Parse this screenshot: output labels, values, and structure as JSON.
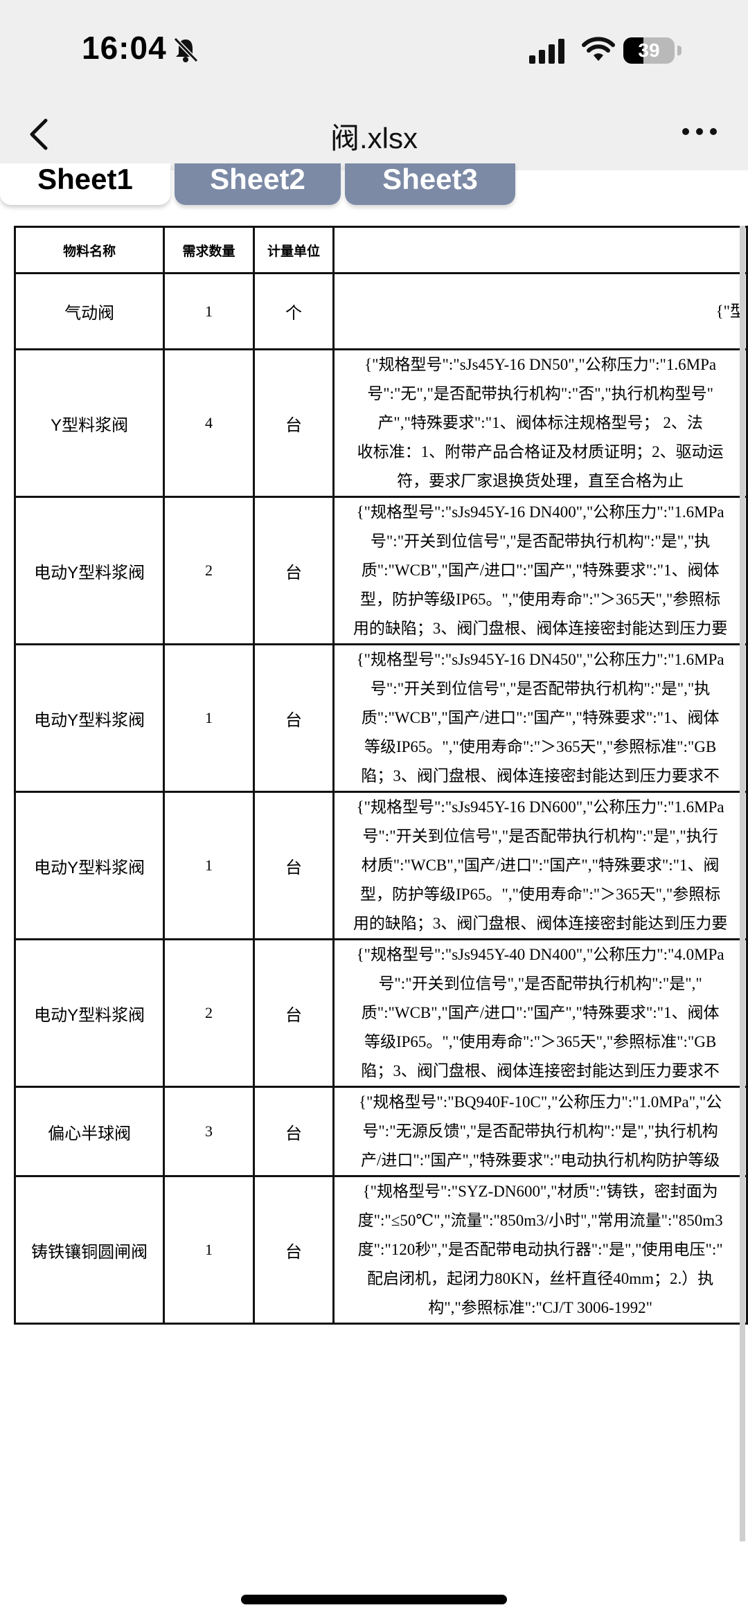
{
  "status_bar": {
    "time": "16:04",
    "battery_level": "39",
    "battery_fraction": 0.39
  },
  "nav": {
    "title": "阀.xlsx"
  },
  "sheets": [
    "Sheet1",
    "Sheet2",
    "Sheet3"
  ],
  "table": {
    "headers": [
      "物料名称",
      "需求数量",
      "计量单位"
    ],
    "rows": [
      {
        "name": "气动阀",
        "qty": "1",
        "unit": "个",
        "spec": [
          "{\"型"
        ]
      },
      {
        "name": "Y型料浆阀",
        "qty": "4",
        "unit": "台",
        "spec": [
          "{\"规格型号\":\"sJs45Y-16  DN50\",\"公称压力\":\"1.6MPa",
          "号\":\"无\",\"是否配带执行机构\":\"否\",\"执行机构型号\"",
          "产\",\"特殊要求\":\"1、阀体标注规格型号；          2、法",
          "收标准：1、附带产品合格证及材质证明；2、驱动运",
          "符，要求厂家退换货处理，直至合格为止"
        ]
      },
      {
        "name": "电动Y型料浆阀",
        "qty": "2",
        "unit": "台",
        "spec": [
          "{\"规格型号\":\"sJs945Y-16  DN400\",\"公称压力\":\"1.6MPa",
          "号\":\"开关到位信号\",\"是否配带执行机构\":\"是\",\"执",
          "质\":\"WCB\",\"国产/进口\":\"国产\",\"特殊要求\":\"1、阀体",
          "型，防护等级IP65。\",\"使用寿命\":\"＞365天\",\"参照标",
          "用的缺陷；3、阀门盘根、阀体连接密封能达到压力要"
        ]
      },
      {
        "name": "电动Y型料浆阀",
        "qty": "1",
        "unit": "台",
        "spec": [
          "{\"规格型号\":\"sJs945Y-16  DN450\",\"公称压力\":\"1.6MPa",
          "号\":\"开关到位信号\",\"是否配带执行机构\":\"是\",\"执",
          "质\":\"WCB\",\"国产/进口\":\"国产\",\"特殊要求\":\"1、阀体",
          "等级IP65。\",\"使用寿命\":\"＞365天\",\"参照标准\":\"GB",
          "陷；3、阀门盘根、阀体连接密封能达到压力要求不"
        ]
      },
      {
        "name": "电动Y型料浆阀",
        "qty": "1",
        "unit": "台",
        "spec": [
          "{\"规格型号\":\"sJs945Y-16  DN600\",\"公称压力\":\"1.6MPa",
          "号\":\"开关到位信号\",\"是否配带执行机构\":\"是\",\"执行",
          "材质\":\"WCB\",\"国产/进口\":\"国产\",\"特殊要求\":\"1、阀",
          "型，防护等级IP65。\",\"使用寿命\":\"＞365天\",\"参照标",
          "用的缺陷；3、阀门盘根、阀体连接密封能达到压力要"
        ]
      },
      {
        "name": "电动Y型料浆阀",
        "qty": "2",
        "unit": "台",
        "spec": [
          "{\"规格型号\":\"sJs945Y-40  DN400\",\"公称压力\":\"4.0MPa",
          "号\":\"开关到位信号\",\"是否配带执行机构\":\"是\",\"",
          "质\":\"WCB\",\"国产/进口\":\"国产\",\"特殊要求\":\"1、阀体",
          "等级IP65。\",\"使用寿命\":\"＞365天\",\"参照标准\":\"GB",
          "陷；3、阀门盘根、阀体连接密封能达到压力要求不"
        ]
      },
      {
        "name": "偏心半球阀",
        "qty": "3",
        "unit": "台",
        "spec": [
          "{\"规格型号\":\"BQ940F-10C\",\"公称压力\":\"1.0MPa\",\"公",
          "号\":\"无源反馈\",\"是否配带执行机构\":\"是\",\"执行机构",
          "产/进口\":\"国产\",\"特殊要求\":\"电动执行机构防护等级"
        ]
      },
      {
        "name": "铸铁镶铜圆闸阀",
        "qty": "1",
        "unit": "台",
        "spec": [
          "{\"规格型号\":\"SYZ-DN600\",\"材质\":\"铸铁，密封面为",
          "度\":\"≤50℃\",\"流量\":\"850m3/小时\",\"常用流量\":\"850m3",
          "度\":\"120秒\",\"是否配带电动执行器\":\"是\",\"使用电压\":\"",
          "配启闭机，起闭力80KN，丝杆直径40mm；2.）执",
          "构\",\"参照标准\":\"CJ/T 3006-1992\""
        ]
      }
    ]
  }
}
